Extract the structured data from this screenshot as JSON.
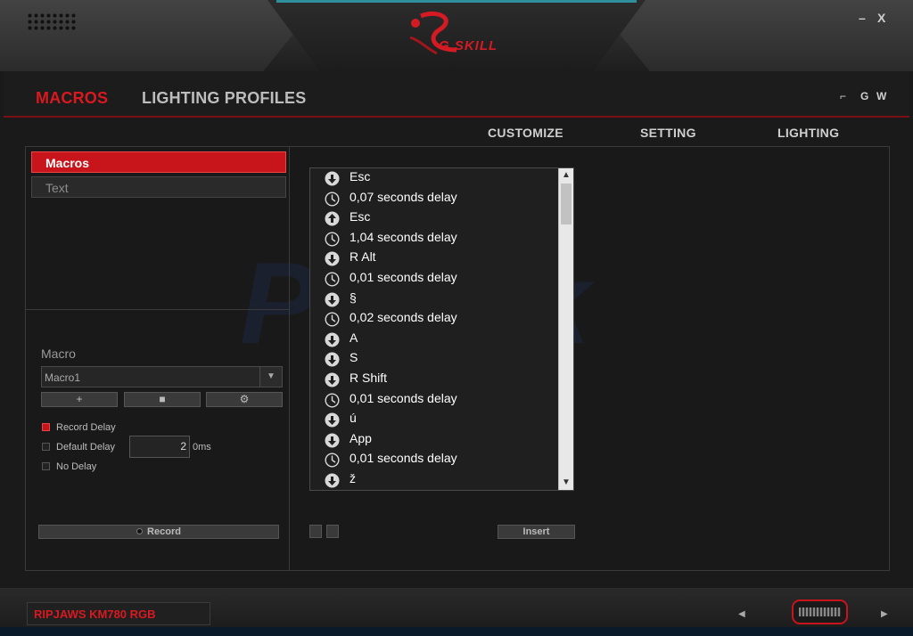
{
  "window": {
    "minimize_label": "–",
    "close_label": "X"
  },
  "logo": {
    "text": "G.SKILL",
    "colors": {
      "brand": "#d41a22"
    }
  },
  "nav": {
    "tabs": [
      {
        "label": "MACROS"
      },
      {
        "label": "LIGHTING PROFILES"
      }
    ],
    "right": [
      {
        "label": "⌐"
      },
      {
        "label": "G"
      },
      {
        "label": "W"
      }
    ]
  },
  "subnav": [
    {
      "label": "CUSTOMIZE"
    },
    {
      "label": "SETTING"
    },
    {
      "label": "LIGHTING"
    }
  ],
  "left": {
    "tabs": [
      {
        "label": "Macros"
      },
      {
        "label": "Text"
      }
    ],
    "macro_label": "Macro",
    "dropdown_value": "Macro1",
    "buttons": [
      {
        "label": "+"
      },
      {
        "label": "■"
      },
      {
        "label": "⚙"
      }
    ],
    "options": [
      {
        "label": "Record Delay",
        "checked": true
      },
      {
        "label": "Default Delay",
        "checked": false
      },
      {
        "label": "No Delay",
        "checked": false
      }
    ],
    "default_delay_value": "2",
    "delay_unit": "0ms",
    "record_label": "Record"
  },
  "watermark": "PCtsk",
  "list": {
    "rows": [
      {
        "icon": "key-down",
        "text": "Esc"
      },
      {
        "icon": "clock",
        "text": "0,07 seconds delay"
      },
      {
        "icon": "key-up",
        "text": "Esc"
      },
      {
        "icon": "clock",
        "text": "1,04 seconds delay"
      },
      {
        "icon": "key-down",
        "text": "R Alt"
      },
      {
        "icon": "clock",
        "text": "0,01 seconds delay"
      },
      {
        "icon": "key-down",
        "text": "§"
      },
      {
        "icon": "clock",
        "text": "0,02 seconds delay"
      },
      {
        "icon": "key-down",
        "text": "A"
      },
      {
        "icon": "key-down",
        "text": "S"
      },
      {
        "icon": "key-down",
        "text": "R Shift"
      },
      {
        "icon": "clock",
        "text": "0,01 seconds delay"
      },
      {
        "icon": "key-down",
        "text": "ú"
      },
      {
        "icon": "key-down",
        "text": "App"
      },
      {
        "icon": "clock",
        "text": "0,01 seconds delay"
      },
      {
        "icon": "key-down",
        "text": "ž"
      }
    ]
  },
  "insert_label": "Insert",
  "device_name": "RIPJAWS KM780 RGB",
  "colors": {
    "accent": "#c8141b"
  }
}
